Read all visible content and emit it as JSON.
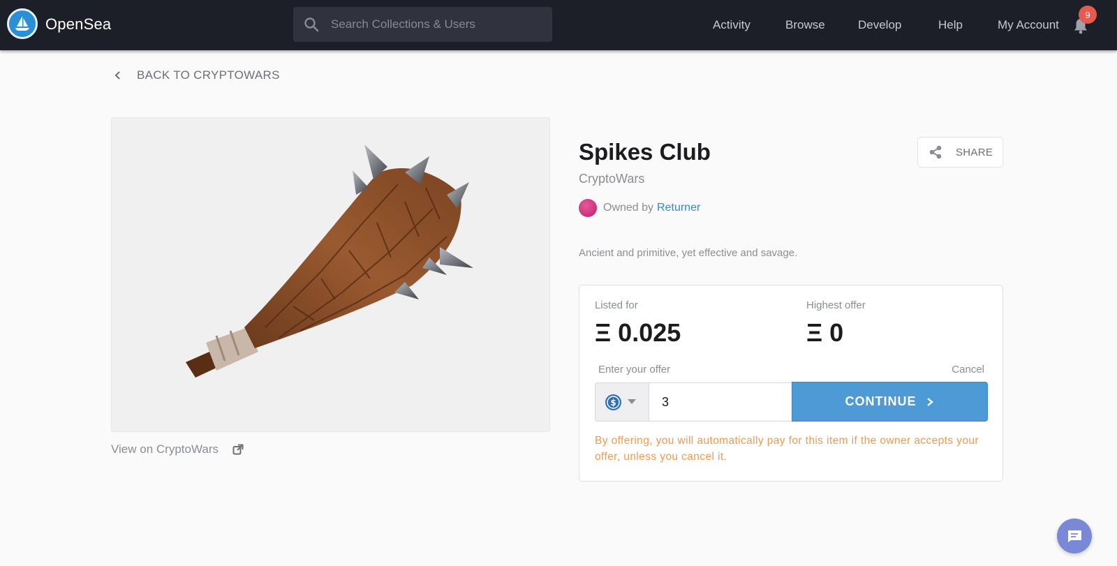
{
  "header": {
    "brand": "OpenSea",
    "search_placeholder": "Search Collections & Users",
    "nav": [
      "Activity",
      "Browse",
      "Develop",
      "Help",
      "My Account"
    ],
    "notification_count": "9"
  },
  "breadcrumb": {
    "back_label": "BACK TO CRYPTOWARS"
  },
  "item": {
    "image_icon": "spiked-club-image",
    "view_on_label": "View on CryptoWars",
    "title": "Spikes Club",
    "collection": "CryptoWars",
    "owned_by_label": "Owned by",
    "owner": "Returner",
    "description": "Ancient and primitive, yet effective and savage.",
    "share_label": "SHARE"
  },
  "offer": {
    "listed_for_label": "Listed for",
    "listed_for_value": "Ξ 0.025",
    "highest_offer_label": "Highest offer",
    "highest_offer_value": "Ξ 0",
    "enter_offer_label": "Enter your offer",
    "cancel_label": "Cancel",
    "currency_icon": "usdc-coin-icon",
    "amount_value": "3",
    "continue_label": "CONTINUE",
    "warning": "By offering, you will automatically pay for this item if the owner accepts your offer, unless you cancel it."
  },
  "colors": {
    "navbar": "#1c1f27",
    "accent": "#4d9ad6",
    "link": "#2e8ad8",
    "warning": "#ee9b52",
    "badge": "#e55b4f",
    "chat": "#7a89d6"
  }
}
